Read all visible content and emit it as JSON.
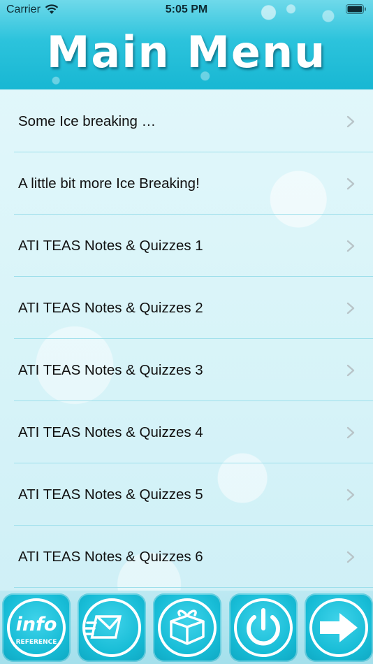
{
  "status_bar": {
    "carrier": "Carrier",
    "time": "5:05 PM"
  },
  "header": {
    "title": "Main Menu"
  },
  "menu": {
    "items": [
      {
        "label": "Some Ice breaking …"
      },
      {
        "label": "A little bit more Ice Breaking!"
      },
      {
        "label": "ATI TEAS Notes & Quizzes 1"
      },
      {
        "label": "ATI TEAS Notes & Quizzes 2"
      },
      {
        "label": "ATI TEAS Notes & Quizzes 3"
      },
      {
        "label": "ATI TEAS Notes & Quizzes 4"
      },
      {
        "label": "ATI TEAS Notes & Quizzes 5"
      },
      {
        "label": "ATI TEAS Notes & Quizzes 6"
      }
    ]
  },
  "toolbar": {
    "info_button": {
      "text": "info",
      "subtext": "REFERENCE",
      "icon": "info-reference-icon"
    },
    "email_button": {
      "icon": "email-icon"
    },
    "gift_button": {
      "icon": "gift-icon"
    },
    "power_button": {
      "icon": "power-icon"
    },
    "next_button": {
      "icon": "arrow-right-icon"
    }
  },
  "colors": {
    "accent": "#18b7d3",
    "separator": "#9edfeb",
    "text": "#111111"
  }
}
